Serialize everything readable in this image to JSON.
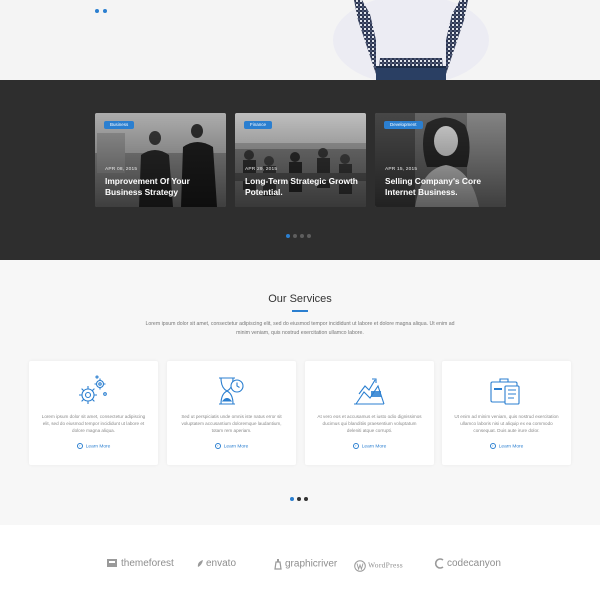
{
  "blog": {
    "posts": [
      {
        "tag": "Business",
        "date": "APR 08, 2015",
        "title": "Improvement Of Your Business Strategy"
      },
      {
        "tag": "Finance",
        "date": "APR 29, 2015",
        "title": "Long-Term Strategic Growth Potential."
      },
      {
        "tag": "Development",
        "date": "APR 15, 2015",
        "title": "Selling Company's Core Internet Business."
      }
    ]
  },
  "services": {
    "title": "Our Services",
    "intro": "Lorem ipsum dolor sit amet, consectetur adipiscing elit, sed do eiusmod tempor incididunt ut labore et dolore magna aliqua. Ut enim ad minim veniam, quis nostrud exercitation ullamco labore.",
    "cards": [
      {
        "icon": "gears-icon",
        "text": "Lorem ipsum dolor sit amet, consectetur adipiscing elit, sed do eiusmod tempor incididunt ut labore et dolore magna aliqua.",
        "link": "Learn More"
      },
      {
        "icon": "hourglass-clock-icon",
        "text": "Sed ut perspiciatis unde omnis iste natus error sit voluptatem accusantium doloremque laudantium, totam rem aperiam.",
        "link": "Learn More"
      },
      {
        "icon": "growth-chart-icon",
        "text": "At vero eos et accusamus et iusto odio dignissimos ducimus qui blanditiis praesentium voluptatum deleniti atque corrupti.",
        "link": "Learn More"
      },
      {
        "icon": "briefcase-clipboard-icon",
        "text": "Ut enim ad minim veniam, quis nostrud exercitation ullamco laboris nisi ut aliquip ex ea commodo consequat. Duis aute irure dolor.",
        "link": "Learn More"
      }
    ]
  },
  "partners": {
    "logos": [
      "themeforest",
      "envato",
      "graphicriver",
      "WordPress",
      "codecanyon"
    ]
  },
  "colors": {
    "accent": "#2b7fd0",
    "dark_band": "#2e2e2e"
  }
}
